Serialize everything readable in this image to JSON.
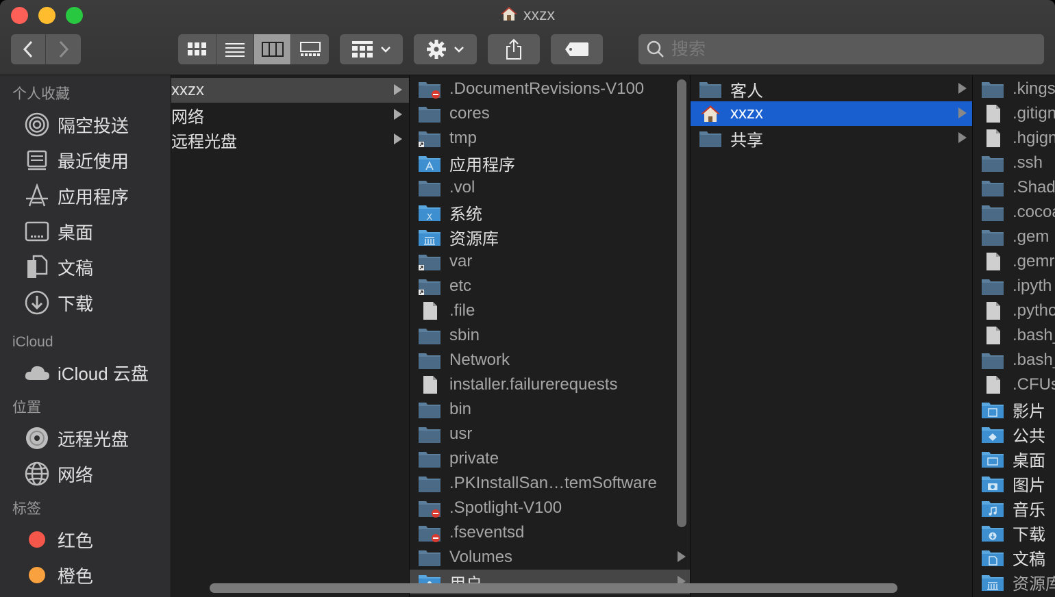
{
  "window": {
    "title": "xxzx"
  },
  "toolbar": {
    "back_icon": "chevron-left-icon",
    "forward_icon": "chevron-right-icon",
    "view_modes": [
      "icon-view",
      "list-view",
      "column-view",
      "gallery-view"
    ],
    "active_view": "column-view",
    "group_icon": "group-grid-icon",
    "action_icon": "gear-icon",
    "share_icon": "share-icon",
    "tag_icon": "tag-icon",
    "search_placeholder": "搜索"
  },
  "sidebar": {
    "favorites_label": "个人收藏",
    "favorites": [
      {
        "label": "隔空投送",
        "icon": "airdrop-icon"
      },
      {
        "label": "最近使用",
        "icon": "recents-icon"
      },
      {
        "label": "应用程序",
        "icon": "applications-icon"
      },
      {
        "label": "桌面",
        "icon": "desktop-icon"
      },
      {
        "label": "文稿",
        "icon": "documents-icon"
      },
      {
        "label": "下载",
        "icon": "downloads-icon"
      }
    ],
    "icloud_label": "iCloud",
    "icloud": [
      {
        "label": "iCloud 云盘",
        "icon": "cloud-icon"
      }
    ],
    "locations_label": "位置",
    "locations": [
      {
        "label": "远程光盘",
        "icon": "disc-icon"
      },
      {
        "label": "网络",
        "icon": "network-icon"
      }
    ],
    "tags_label": "标签",
    "tags": [
      {
        "label": "红色",
        "color": "#f5564a"
      },
      {
        "label": "橙色",
        "color": "#f9a03f"
      }
    ]
  },
  "columns": {
    "col1": [
      {
        "label": "xxzx",
        "selected": true
      },
      {
        "label": "网络"
      },
      {
        "label": "远程光盘"
      }
    ],
    "col2": [
      {
        "label": ".DocumentRevisions-V100",
        "icon": "folder-restricted",
        "dim": true
      },
      {
        "label": "cores",
        "icon": "folder",
        "dim": true,
        "chev": true
      },
      {
        "label": "tmp",
        "icon": "folder-alias",
        "dim": true,
        "chev": true
      },
      {
        "label": "应用程序",
        "icon": "folder-apps",
        "chev": true
      },
      {
        "label": ".vol",
        "icon": "folder",
        "dim": true,
        "chev": true
      },
      {
        "label": "系统",
        "icon": "folder-system",
        "chev": true
      },
      {
        "label": "资源库",
        "icon": "folder-library",
        "chev": true
      },
      {
        "label": "var",
        "icon": "folder-alias",
        "dim": true,
        "chev": true
      },
      {
        "label": "etc",
        "icon": "folder-alias",
        "dim": true,
        "chev": true
      },
      {
        "label": ".file",
        "icon": "file",
        "dim": true
      },
      {
        "label": "sbin",
        "icon": "folder",
        "dim": true,
        "chev": true
      },
      {
        "label": "Network",
        "icon": "folder",
        "dim": true,
        "chev": true
      },
      {
        "label": "installer.failurerequests",
        "icon": "file",
        "dim": true
      },
      {
        "label": "bin",
        "icon": "folder",
        "dim": true,
        "chev": true
      },
      {
        "label": "usr",
        "icon": "folder",
        "dim": true,
        "chev": true
      },
      {
        "label": "private",
        "icon": "folder",
        "dim": true,
        "chev": true
      },
      {
        "label": ".PKInstallSan…temSoftware",
        "icon": "folder",
        "dim": true,
        "chev": true
      },
      {
        "label": ".Spotlight-V100",
        "icon": "folder-restricted",
        "dim": true
      },
      {
        "label": ".fseventsd",
        "icon": "folder-restricted",
        "dim": true
      },
      {
        "label": "Volumes",
        "icon": "folder",
        "dim": true,
        "chev": true
      },
      {
        "label": "用户",
        "icon": "folder-users",
        "chev": true,
        "selected": true
      }
    ],
    "col3": [
      {
        "label": "客人",
        "icon": "folder"
      },
      {
        "label": "xxzx",
        "icon": "home",
        "selected": true
      },
      {
        "label": "共享",
        "icon": "folder"
      }
    ],
    "col4": [
      {
        "label": ".kings",
        "icon": "folder",
        "dim": true
      },
      {
        "label": ".gitign",
        "icon": "file",
        "dim": true
      },
      {
        "label": ".hgign",
        "icon": "file",
        "dim": true
      },
      {
        "label": ".ssh",
        "icon": "folder",
        "dim": true
      },
      {
        "label": ".Shad",
        "icon": "folder",
        "dim": true
      },
      {
        "label": ".cocoa",
        "icon": "folder",
        "dim": true
      },
      {
        "label": ".gem",
        "icon": "folder",
        "dim": true
      },
      {
        "label": ".gemr",
        "icon": "file",
        "dim": true
      },
      {
        "label": ".ipyth",
        "icon": "folder",
        "dim": true
      },
      {
        "label": ".pytho",
        "icon": "file",
        "dim": true
      },
      {
        "label": ".bash_",
        "icon": "file",
        "dim": true
      },
      {
        "label": ".bash_",
        "icon": "folder",
        "dim": true
      },
      {
        "label": ".CFUs",
        "icon": "file",
        "dim": true
      },
      {
        "label": "影片",
        "icon": "folder-movies"
      },
      {
        "label": "公共",
        "icon": "folder-public"
      },
      {
        "label": "桌面",
        "icon": "folder-desktop"
      },
      {
        "label": "图片",
        "icon": "folder-pictures"
      },
      {
        "label": "音乐",
        "icon": "folder-music"
      },
      {
        "label": "下载",
        "icon": "folder-downloads"
      },
      {
        "label": "文稿",
        "icon": "folder-documents"
      },
      {
        "label": "资源库",
        "icon": "folder-library",
        "dim": true
      }
    ]
  }
}
